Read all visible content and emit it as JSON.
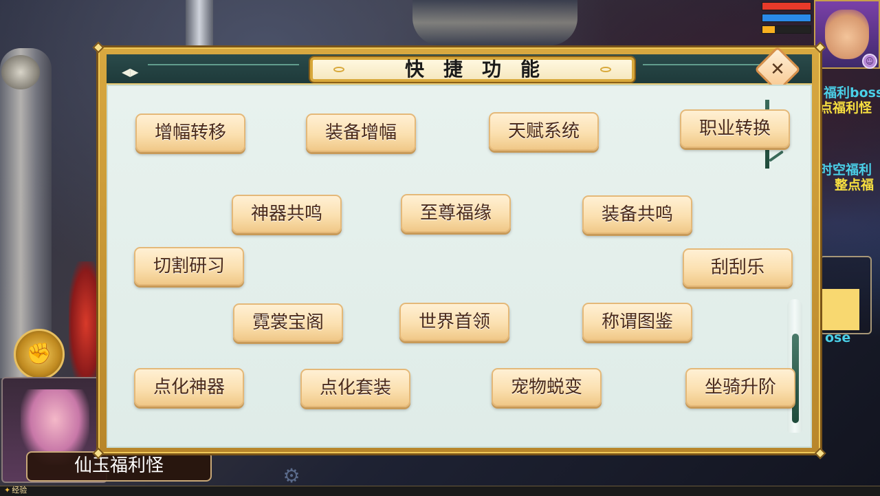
{
  "dialog": {
    "title": "快捷功能",
    "buttons": [
      "增幅转移",
      "装备增幅",
      "天赋系统",
      "职业转换",
      "神器共鸣",
      "至尊福缘",
      "装备共鸣",
      "切割研习",
      "刮刮乐",
      "霓裳宝阁",
      "世界首领",
      "称谓图鉴",
      "点化神器",
      "点化套装",
      "宠物蜕变",
      "坐骑升阶"
    ]
  },
  "hud": {
    "status_bars": [
      {
        "name": "health",
        "value": 1.0,
        "color": "#e83a2a"
      },
      {
        "name": "mana",
        "value": 1.0,
        "color": "#2a8ae8"
      },
      {
        "name": "energy",
        "value": 0.25,
        "color": "#f8b020"
      }
    ],
    "side_texts": [
      "福利boss",
      "点福利怪",
      "时空福利",
      "整点福",
      "ose"
    ],
    "boss_label": "仙玉福利怪",
    "exp_label": "经验"
  },
  "icons": {
    "close": "close-icon",
    "gear": "gear-icon",
    "avatar": "avatar",
    "smile": "smile-icon"
  }
}
